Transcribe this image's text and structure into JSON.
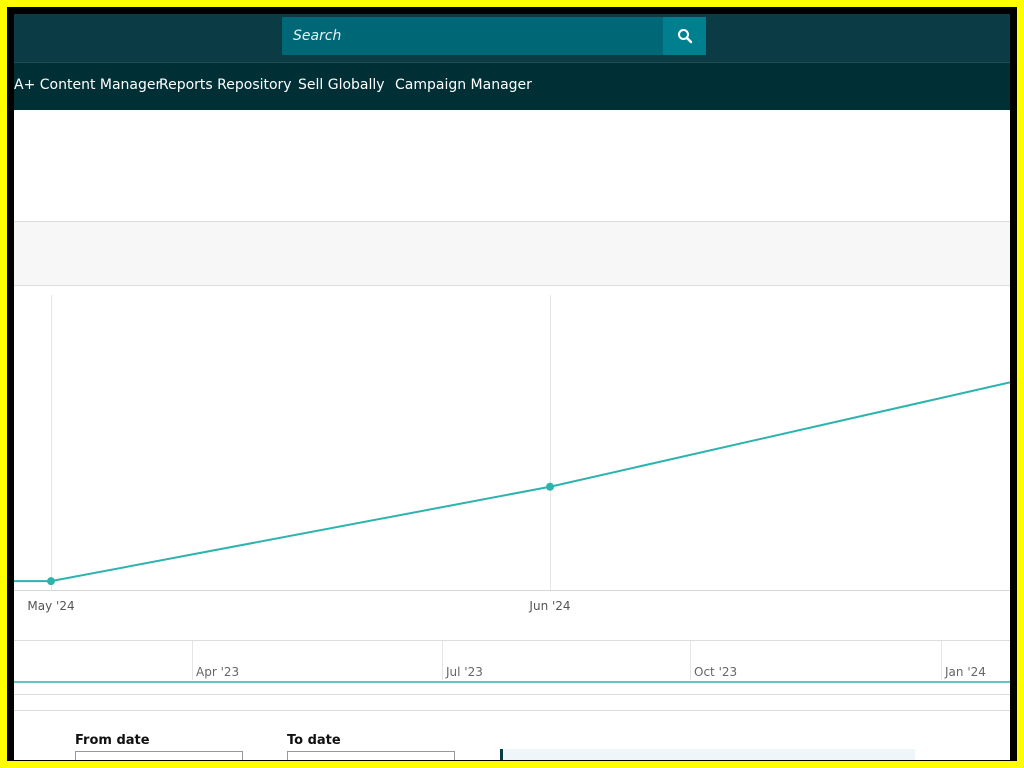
{
  "search": {
    "placeholder": "Search"
  },
  "nav": {
    "items": [
      "A+ Content Manager",
      "Reports Repository",
      "Sell Globally",
      "Campaign Manager"
    ]
  },
  "colors": {
    "frame": "#ffff00",
    "topbar": "#0b3b44",
    "navbar": "#002f36",
    "search_field": "#006776",
    "search_button": "#00808e",
    "series": "#2db3ae"
  },
  "icons": {
    "search_button": "search-icon"
  },
  "chart_data": {
    "type": "line",
    "x_tick_labels": [
      "May '24",
      "Jun '24"
    ],
    "series": [
      {
        "points": [
          {
            "x": "May '24",
            "y": 0.03
          },
          {
            "x": "Jun '24",
            "y": 0.35
          }
        ]
      }
    ],
    "grid": true
  },
  "navigator": {
    "tick_labels": [
      "Apr '23",
      "Jul '23",
      "Oct '23",
      "Jan '24"
    ]
  },
  "form": {
    "from_label": "From date",
    "to_label": "To date"
  }
}
